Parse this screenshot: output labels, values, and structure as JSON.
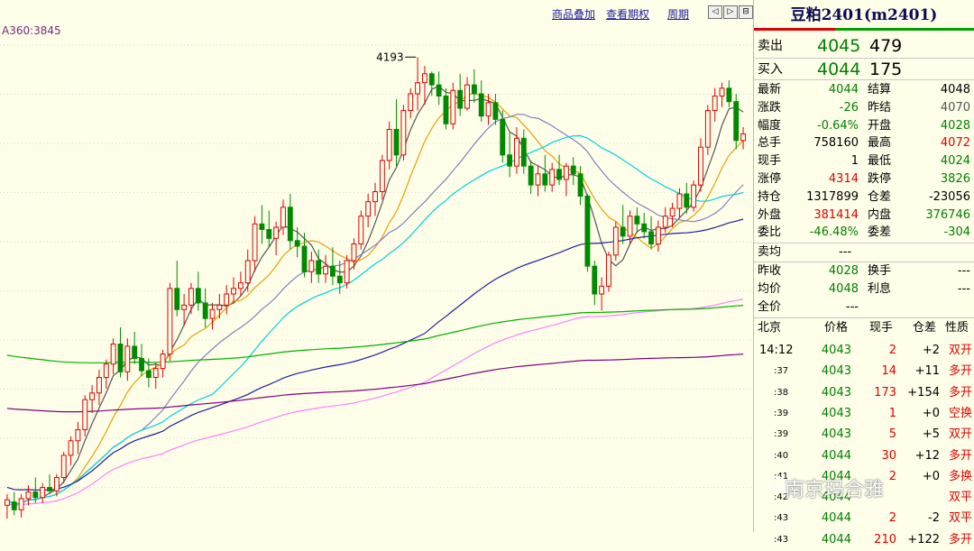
{
  "toolbar": {
    "overlay_label": "商品叠加",
    "options_label": "查看期权",
    "period_label": "周期",
    "prev_icon": "◁",
    "next_icon": "▷",
    "zoom_icon": "⊟"
  },
  "indicator_label": "A360:3845",
  "chart_data": {
    "type": "candlestick",
    "peak_annotation": "4193",
    "candles": [
      {
        "o": 3790,
        "h": 3800,
        "l": 3778,
        "c": 3795
      },
      {
        "o": 3793,
        "h": 3802,
        "l": 3781,
        "c": 3786
      },
      {
        "o": 3786,
        "h": 3800,
        "l": 3779,
        "c": 3796
      },
      {
        "o": 3796,
        "h": 3808,
        "l": 3790,
        "c": 3802
      },
      {
        "o": 3802,
        "h": 3815,
        "l": 3792,
        "c": 3797
      },
      {
        "o": 3797,
        "h": 3810,
        "l": 3792,
        "c": 3806
      },
      {
        "o": 3806,
        "h": 3818,
        "l": 3800,
        "c": 3803
      },
      {
        "o": 3803,
        "h": 3818,
        "l": 3798,
        "c": 3815
      },
      {
        "o": 3815,
        "h": 3838,
        "l": 3810,
        "c": 3835
      },
      {
        "o": 3835,
        "h": 3852,
        "l": 3826,
        "c": 3848
      },
      {
        "o": 3848,
        "h": 3865,
        "l": 3836,
        "c": 3858
      },
      {
        "o": 3858,
        "h": 3889,
        "l": 3852,
        "c": 3885
      },
      {
        "o": 3885,
        "h": 3898,
        "l": 3873,
        "c": 3891
      },
      {
        "o": 3891,
        "h": 3912,
        "l": 3880,
        "c": 3905
      },
      {
        "o": 3905,
        "h": 3921,
        "l": 3895,
        "c": 3917
      },
      {
        "o": 3917,
        "h": 3940,
        "l": 3908,
        "c": 3935
      },
      {
        "o": 3935,
        "h": 3950,
        "l": 3905,
        "c": 3910
      },
      {
        "o": 3910,
        "h": 3940,
        "l": 3902,
        "c": 3933
      },
      {
        "o": 3933,
        "h": 3946,
        "l": 3917,
        "c": 3922
      },
      {
        "o": 3922,
        "h": 3935,
        "l": 3906,
        "c": 3911
      },
      {
        "o": 3911,
        "h": 3922,
        "l": 3896,
        "c": 3905
      },
      {
        "o": 3905,
        "h": 3918,
        "l": 3895,
        "c": 3913
      },
      {
        "o": 3913,
        "h": 3930,
        "l": 3905,
        "c": 3926
      },
      {
        "o": 3926,
        "h": 3990,
        "l": 3920,
        "c": 3985
      },
      {
        "o": 3985,
        "h": 4010,
        "l": 3960,
        "c": 3966
      },
      {
        "o": 3966,
        "h": 3980,
        "l": 3952,
        "c": 3970
      },
      {
        "o": 3970,
        "h": 3990,
        "l": 3962,
        "c": 3985
      },
      {
        "o": 3985,
        "h": 4000,
        "l": 3965,
        "c": 3972
      },
      {
        "o": 3972,
        "h": 3985,
        "l": 3950,
        "c": 3958
      },
      {
        "o": 3958,
        "h": 3972,
        "l": 3948,
        "c": 3966
      },
      {
        "o": 3966,
        "h": 3980,
        "l": 3958,
        "c": 3970
      },
      {
        "o": 3970,
        "h": 3988,
        "l": 3962,
        "c": 3980
      },
      {
        "o": 3980,
        "h": 3995,
        "l": 3972,
        "c": 3985
      },
      {
        "o": 3985,
        "h": 4000,
        "l": 3978,
        "c": 3990
      },
      {
        "o": 3990,
        "h": 4020,
        "l": 3982,
        "c": 4010
      },
      {
        "o": 4010,
        "h": 4050,
        "l": 4000,
        "c": 4043
      },
      {
        "o": 4043,
        "h": 4060,
        "l": 4025,
        "c": 4038
      },
      {
        "o": 4038,
        "h": 4055,
        "l": 4022,
        "c": 4030
      },
      {
        "o": 4030,
        "h": 4045,
        "l": 4015,
        "c": 4040
      },
      {
        "o": 4040,
        "h": 4065,
        "l": 4033,
        "c": 4058
      },
      {
        "o": 4058,
        "h": 4070,
        "l": 4020,
        "c": 4028
      },
      {
        "o": 4028,
        "h": 4040,
        "l": 4013,
        "c": 4023
      },
      {
        "o": 4023,
        "h": 4035,
        "l": 3995,
        "c": 4000
      },
      {
        "o": 4000,
        "h": 4018,
        "l": 3990,
        "c": 4010
      },
      {
        "o": 4010,
        "h": 4020,
        "l": 3990,
        "c": 3998
      },
      {
        "o": 3998,
        "h": 4015,
        "l": 3990,
        "c": 4005
      },
      {
        "o": 4005,
        "h": 4022,
        "l": 3988,
        "c": 3996
      },
      {
        "o": 3996,
        "h": 4010,
        "l": 3980,
        "c": 3990
      },
      {
        "o": 3990,
        "h": 4015,
        "l": 3985,
        "c": 4010
      },
      {
        "o": 4010,
        "h": 4030,
        "l": 4002,
        "c": 4025
      },
      {
        "o": 4025,
        "h": 4055,
        "l": 4020,
        "c": 4050
      },
      {
        "o": 4050,
        "h": 4070,
        "l": 4040,
        "c": 4063
      },
      {
        "o": 4063,
        "h": 4080,
        "l": 4050,
        "c": 4072
      },
      {
        "o": 4072,
        "h": 4105,
        "l": 4065,
        "c": 4100
      },
      {
        "o": 4100,
        "h": 4135,
        "l": 4092,
        "c": 4128
      },
      {
        "o": 4128,
        "h": 4155,
        "l": 4095,
        "c": 4105
      },
      {
        "o": 4105,
        "h": 4150,
        "l": 4100,
        "c": 4145
      },
      {
        "o": 4145,
        "h": 4165,
        "l": 4138,
        "c": 4160
      },
      {
        "o": 4160,
        "h": 4193,
        "l": 4145,
        "c": 4170
      },
      {
        "o": 4170,
        "h": 4185,
        "l": 4150,
        "c": 4178
      },
      {
        "o": 4178,
        "h": 4180,
        "l": 4158,
        "c": 4168
      },
      {
        "o": 4168,
        "h": 4180,
        "l": 4150,
        "c": 4158
      },
      {
        "o": 4158,
        "h": 4165,
        "l": 4128,
        "c": 4133
      },
      {
        "o": 4133,
        "h": 4170,
        "l": 4128,
        "c": 4163
      },
      {
        "o": 4163,
        "h": 4178,
        "l": 4140,
        "c": 4147
      },
      {
        "o": 4147,
        "h": 4175,
        "l": 4145,
        "c": 4168
      },
      {
        "o": 4168,
        "h": 4182,
        "l": 4152,
        "c": 4160
      },
      {
        "o": 4160,
        "h": 4172,
        "l": 4135,
        "c": 4140
      },
      {
        "o": 4140,
        "h": 4160,
        "l": 4132,
        "c": 4152
      },
      {
        "o": 4152,
        "h": 4160,
        "l": 4132,
        "c": 4137
      },
      {
        "o": 4137,
        "h": 4145,
        "l": 4098,
        "c": 4105
      },
      {
        "o": 4105,
        "h": 4125,
        "l": 4085,
        "c": 4095
      },
      {
        "o": 4095,
        "h": 4130,
        "l": 4088,
        "c": 4120
      },
      {
        "o": 4120,
        "h": 4128,
        "l": 4088,
        "c": 4095
      },
      {
        "o": 4095,
        "h": 4100,
        "l": 4070,
        "c": 4078
      },
      {
        "o": 4078,
        "h": 4095,
        "l": 4068,
        "c": 4088
      },
      {
        "o": 4088,
        "h": 4105,
        "l": 4072,
        "c": 4078
      },
      {
        "o": 4078,
        "h": 4098,
        "l": 4072,
        "c": 4092
      },
      {
        "o": 4092,
        "h": 4105,
        "l": 4078,
        "c": 4083
      },
      {
        "o": 4083,
        "h": 4098,
        "l": 4068,
        "c": 4095
      },
      {
        "o": 4095,
        "h": 4103,
        "l": 4078,
        "c": 4088
      },
      {
        "o": 4088,
        "h": 4095,
        "l": 4060,
        "c": 4068
      },
      {
        "o": 4068,
        "h": 4070,
        "l": 4000,
        "c": 4005
      },
      {
        "o": 4005,
        "h": 4010,
        "l": 3970,
        "c": 3980
      },
      {
        "o": 3980,
        "h": 3995,
        "l": 3965,
        "c": 3987
      },
      {
        "o": 3987,
        "h": 4018,
        "l": 3982,
        "c": 4015
      },
      {
        "o": 4015,
        "h": 4045,
        "l": 4010,
        "c": 4040
      },
      {
        "o": 4040,
        "h": 4060,
        "l": 4025,
        "c": 4032
      },
      {
        "o": 4032,
        "h": 4055,
        "l": 4025,
        "c": 4050
      },
      {
        "o": 4050,
        "h": 4058,
        "l": 4035,
        "c": 4043
      },
      {
        "o": 4043,
        "h": 4053,
        "l": 4030,
        "c": 4036
      },
      {
        "o": 4036,
        "h": 4050,
        "l": 4020,
        "c": 4025
      },
      {
        "o": 4025,
        "h": 4046,
        "l": 4018,
        "c": 4040
      },
      {
        "o": 4040,
        "h": 4058,
        "l": 4035,
        "c": 4050
      },
      {
        "o": 4050,
        "h": 4062,
        "l": 4040,
        "c": 4057
      },
      {
        "o": 4057,
        "h": 4075,
        "l": 4048,
        "c": 4070
      },
      {
        "o": 4070,
        "h": 4080,
        "l": 4052,
        "c": 4058
      },
      {
        "o": 4058,
        "h": 4082,
        "l": 4054,
        "c": 4078
      },
      {
        "o": 4078,
        "h": 4120,
        "l": 4072,
        "c": 4112
      },
      {
        "o": 4112,
        "h": 4150,
        "l": 4105,
        "c": 4145
      },
      {
        "o": 4145,
        "h": 4165,
        "l": 4135,
        "c": 4158
      },
      {
        "o": 4158,
        "h": 4170,
        "l": 4148,
        "c": 4165
      },
      {
        "o": 4165,
        "h": 4172,
        "l": 4148,
        "c": 4153
      },
      {
        "o": 4153,
        "h": 4160,
        "l": 4110,
        "c": 4118
      },
      {
        "o": 4118,
        "h": 4130,
        "l": 4110,
        "c": 4124
      }
    ],
    "moving_averages": [
      {
        "period": 5,
        "color": "#555555"
      },
      {
        "period": 10,
        "color": "#e8a000"
      },
      {
        "period": 20,
        "color": "#8080c0"
      },
      {
        "period": 30,
        "color": "#00d0e0"
      },
      {
        "period": 60,
        "color": "#2020a0"
      },
      {
        "period": 120,
        "color": "#ff80ff"
      },
      {
        "period": 250,
        "color": "#00b000"
      },
      {
        "period": 360,
        "color": "#800080"
      }
    ],
    "ylim": [
      3770,
      4220
    ]
  },
  "quote": {
    "contract": "豆粕2401(m2401)",
    "sell_label": "卖出",
    "sell_price": "4045",
    "sell_vol": "479",
    "buy_label": "买入",
    "buy_price": "4044",
    "buy_vol": "175",
    "stats": [
      {
        "l1": "最新",
        "v1": "4044",
        "c1": "grn",
        "l2": "结算",
        "v2": "4048",
        "c2": "blk"
      },
      {
        "l1": "涨跌",
        "v1": "-26",
        "c1": "grn",
        "l2": "昨结",
        "v2": "4070",
        "c2": "gry"
      },
      {
        "l1": "幅度",
        "v1": "-0.64%",
        "c1": "grn",
        "l2": "开盘",
        "v2": "4028",
        "c2": "grn"
      },
      {
        "l1": "总手",
        "v1": "758160",
        "c1": "blk",
        "l2": "最高",
        "v2": "4072",
        "c2": "red"
      },
      {
        "l1": "现手",
        "v1": "1",
        "c1": "blk",
        "l2": "最低",
        "v2": "4024",
        "c2": "grn"
      },
      {
        "l1": "涨停",
        "v1": "4314",
        "c1": "red",
        "l2": "跌停",
        "v2": "3826",
        "c2": "grn"
      },
      {
        "l1": "持仓",
        "v1": "1317899",
        "c1": "blk",
        "l2": "仓差",
        "v2": "-23056",
        "c2": "blk"
      },
      {
        "l1": "外盘",
        "v1": "381414",
        "c1": "red",
        "l2": "内盘",
        "v2": "376746",
        "c2": "grn"
      },
      {
        "l1": "委比",
        "v1": "-46.48%",
        "c1": "grn",
        "l2": "委差",
        "v2": "-304",
        "c2": "grn"
      }
    ],
    "avg_label": "卖均",
    "avg_value": "---",
    "stats2": [
      {
        "l1": "昨收",
        "v1": "4028",
        "c1": "grn",
        "l2": "换手",
        "v2": "---",
        "c2": "blk"
      },
      {
        "l1": "均价",
        "v1": "4048",
        "c1": "grn",
        "l2": "利息",
        "v2": "---",
        "c2": "blk"
      },
      {
        "l1": "全价",
        "v1": "---",
        "c1": "blk",
        "l2": "",
        "v2": "",
        "c2": "blk"
      }
    ],
    "ticks_header": {
      "loc": "北京",
      "price": "价格",
      "vol": "现手",
      "oi": "仓差",
      "nature": "性质"
    },
    "ticks": [
      {
        "time": "14:12",
        "price": "4043",
        "vol": "2",
        "oi": "+2",
        "nature": "双开"
      },
      {
        "time": ":37",
        "price": "4043",
        "vol": "14",
        "oi": "+11",
        "nature": "多开"
      },
      {
        "time": ":38",
        "price": "4043",
        "vol": "173",
        "oi": "+154",
        "nature": "多开"
      },
      {
        "time": ":39",
        "price": "4043",
        "vol": "1",
        "oi": "+0",
        "nature": "空换"
      },
      {
        "time": ":39",
        "price": "4043",
        "vol": "5",
        "oi": "+5",
        "nature": "双开"
      },
      {
        "time": ":40",
        "price": "4044",
        "vol": "30",
        "oi": "+12",
        "nature": "多开"
      },
      {
        "time": ":41",
        "price": "4044",
        "vol": "2",
        "oi": "+0",
        "nature": "多换"
      },
      {
        "time": ":42",
        "price": "4044",
        "vol": "",
        "oi": "",
        "nature": "双平"
      },
      {
        "time": ":43",
        "price": "4044",
        "vol": "2",
        "oi": "-2",
        "nature": "双平"
      },
      {
        "time": ":43",
        "price": "4044",
        "vol": "210",
        "oi": "+122",
        "nature": "多开"
      }
    ]
  },
  "watermark": "南京玛合雅"
}
